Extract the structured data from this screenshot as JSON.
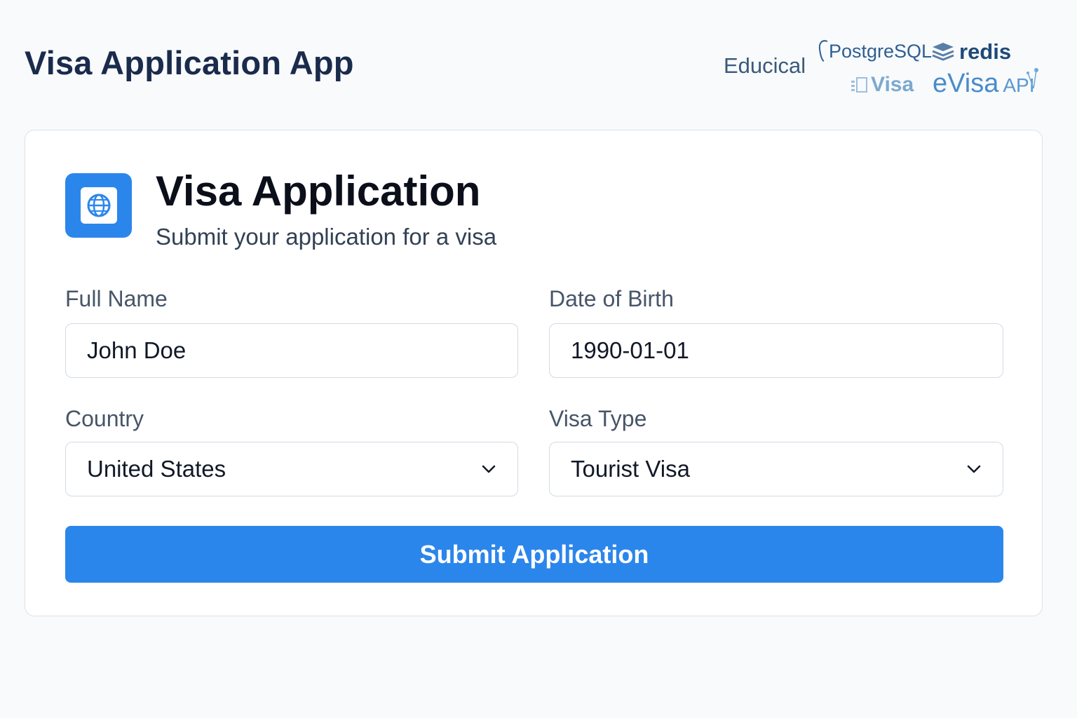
{
  "header": {
    "app_title": "Visa Application App",
    "logos": {
      "educical": "Educical",
      "postgres": "PostgreSQL",
      "redis": "redis",
      "visa": "Visa",
      "evisa": "eVisa",
      "evisa_api": "API"
    }
  },
  "card": {
    "icon": "globe-icon",
    "title": "Visa Application",
    "subtitle": "Submit your application for a visa"
  },
  "form": {
    "full_name": {
      "label": "Full Name",
      "value": "John Doe"
    },
    "date_of_birth": {
      "label": "Date of Birth",
      "value": "1990-01-01"
    },
    "country": {
      "label": "Country",
      "value": "United States"
    },
    "visa_type": {
      "label": "Visa Type",
      "value": "Tourist Visa"
    },
    "submit_label": "Submit Application"
  },
  "colors": {
    "accent": "#2b86eb",
    "title": "#1a2b4c",
    "background": "#f8fafc"
  }
}
